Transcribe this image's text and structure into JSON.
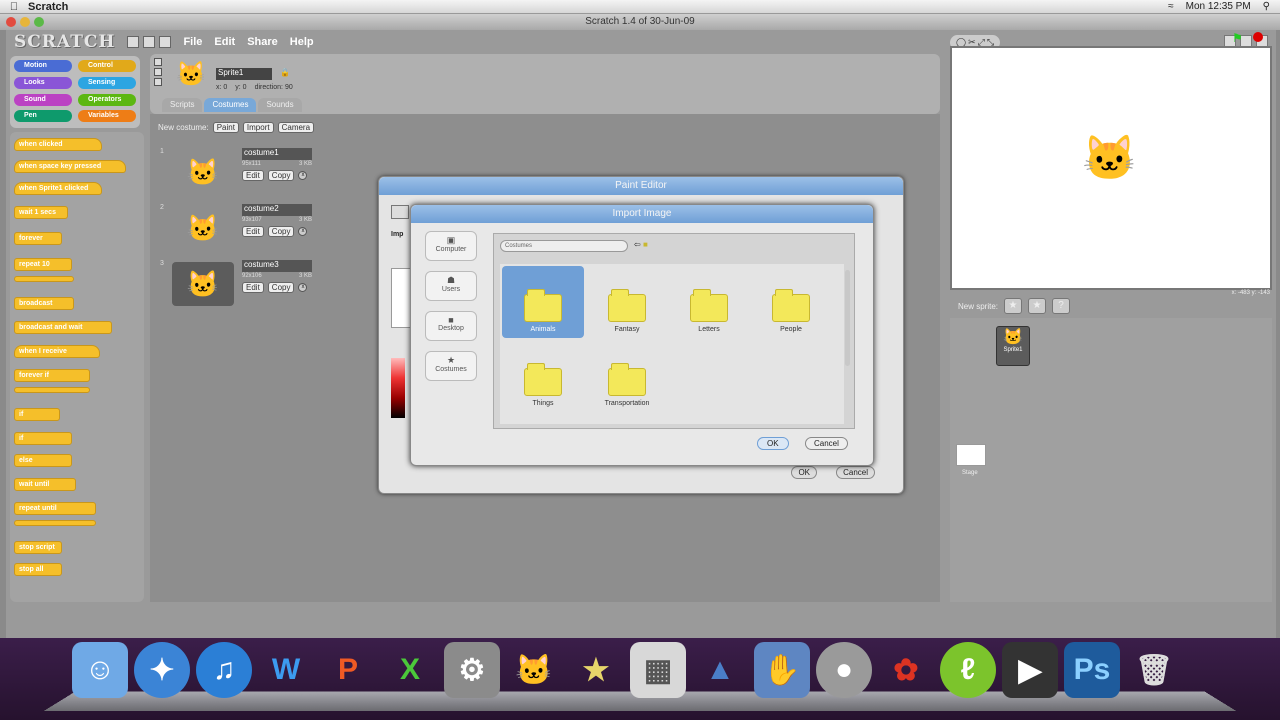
{
  "menubar": {
    "app_name": "Scratch",
    "clock": "Mon 12:35 PM"
  },
  "window": {
    "title": "Scratch 1.4 of 30-Jun-09"
  },
  "toolbar": {
    "logo": "SCRATCH",
    "menus": [
      "File",
      "Edit",
      "Share",
      "Help"
    ]
  },
  "categories": [
    {
      "label": "Motion",
      "color": "#4a6cd4"
    },
    {
      "label": "Control",
      "color": "#e1a91a"
    },
    {
      "label": "Looks",
      "color": "#8a55d7"
    },
    {
      "label": "Sensing",
      "color": "#2ca5e2"
    },
    {
      "label": "Sound",
      "color": "#bb42c3"
    },
    {
      "label": "Operators",
      "color": "#5cb712"
    },
    {
      "label": "Pen",
      "color": "#0e9a6c"
    },
    {
      "label": "Variables",
      "color": "#ee7d16"
    }
  ],
  "blocks": [
    "when clicked",
    "when space key pressed",
    "when Sprite1 clicked",
    "wait 1 secs",
    "forever",
    "repeat 10",
    "",
    "broadcast",
    "broadcast and wait",
    "when I receive",
    "forever if",
    "",
    "if",
    "if",
    "else",
    "wait until",
    "repeat until",
    "",
    "stop script",
    "stop all"
  ],
  "sprite": {
    "name": "Sprite1",
    "x": "x: 0",
    "y": "y: 0",
    "direction": "direction: 90"
  },
  "tabs": [
    "Scripts",
    "Costumes",
    "Sounds"
  ],
  "costumes_panel": {
    "new_label": "New costume:",
    "buttons": [
      "Paint",
      "Import",
      "Camera"
    ],
    "edit_label": "Edit",
    "copy_label": "Copy",
    "items": [
      {
        "num": "1",
        "name": "costume1",
        "size": "95x111",
        "kb": "3 KB"
      },
      {
        "num": "2",
        "name": "costume2",
        "size": "93x107",
        "kb": "3 KB"
      },
      {
        "num": "3",
        "name": "costume3",
        "size": "92x106",
        "kb": "3 KB"
      }
    ]
  },
  "stage": {
    "coords": "x: -483   y: -143"
  },
  "new_sprite": {
    "label": "New sprite:"
  },
  "sprite_list": {
    "sprite_label": "Sprite1",
    "stage_label": "Stage"
  },
  "paint_editor": {
    "title": "Paint Editor",
    "ok": "OK",
    "cancel": "Cancel",
    "import_label": "Imp"
  },
  "import_dialog": {
    "title": "Import Image",
    "path": "Costumes",
    "shortcuts": [
      "Computer",
      "Users",
      "Desktop",
      "Costumes"
    ],
    "folders": [
      "Animals",
      "Fantasy",
      "Letters",
      "People",
      "Things",
      "Transportation"
    ],
    "ok": "OK",
    "cancel": "Cancel"
  },
  "dock": {
    "apps": [
      "Finder",
      "Safari",
      "iTunes",
      "Word",
      "PowerPoint",
      "Excel",
      "System Preferences",
      "Scratch",
      "iMovie",
      "Calculator",
      "Scripting",
      "Capture",
      "Recorder",
      "Flash",
      "Dreamweaver",
      "Final Cut",
      "Photoshop",
      "Trash"
    ]
  }
}
